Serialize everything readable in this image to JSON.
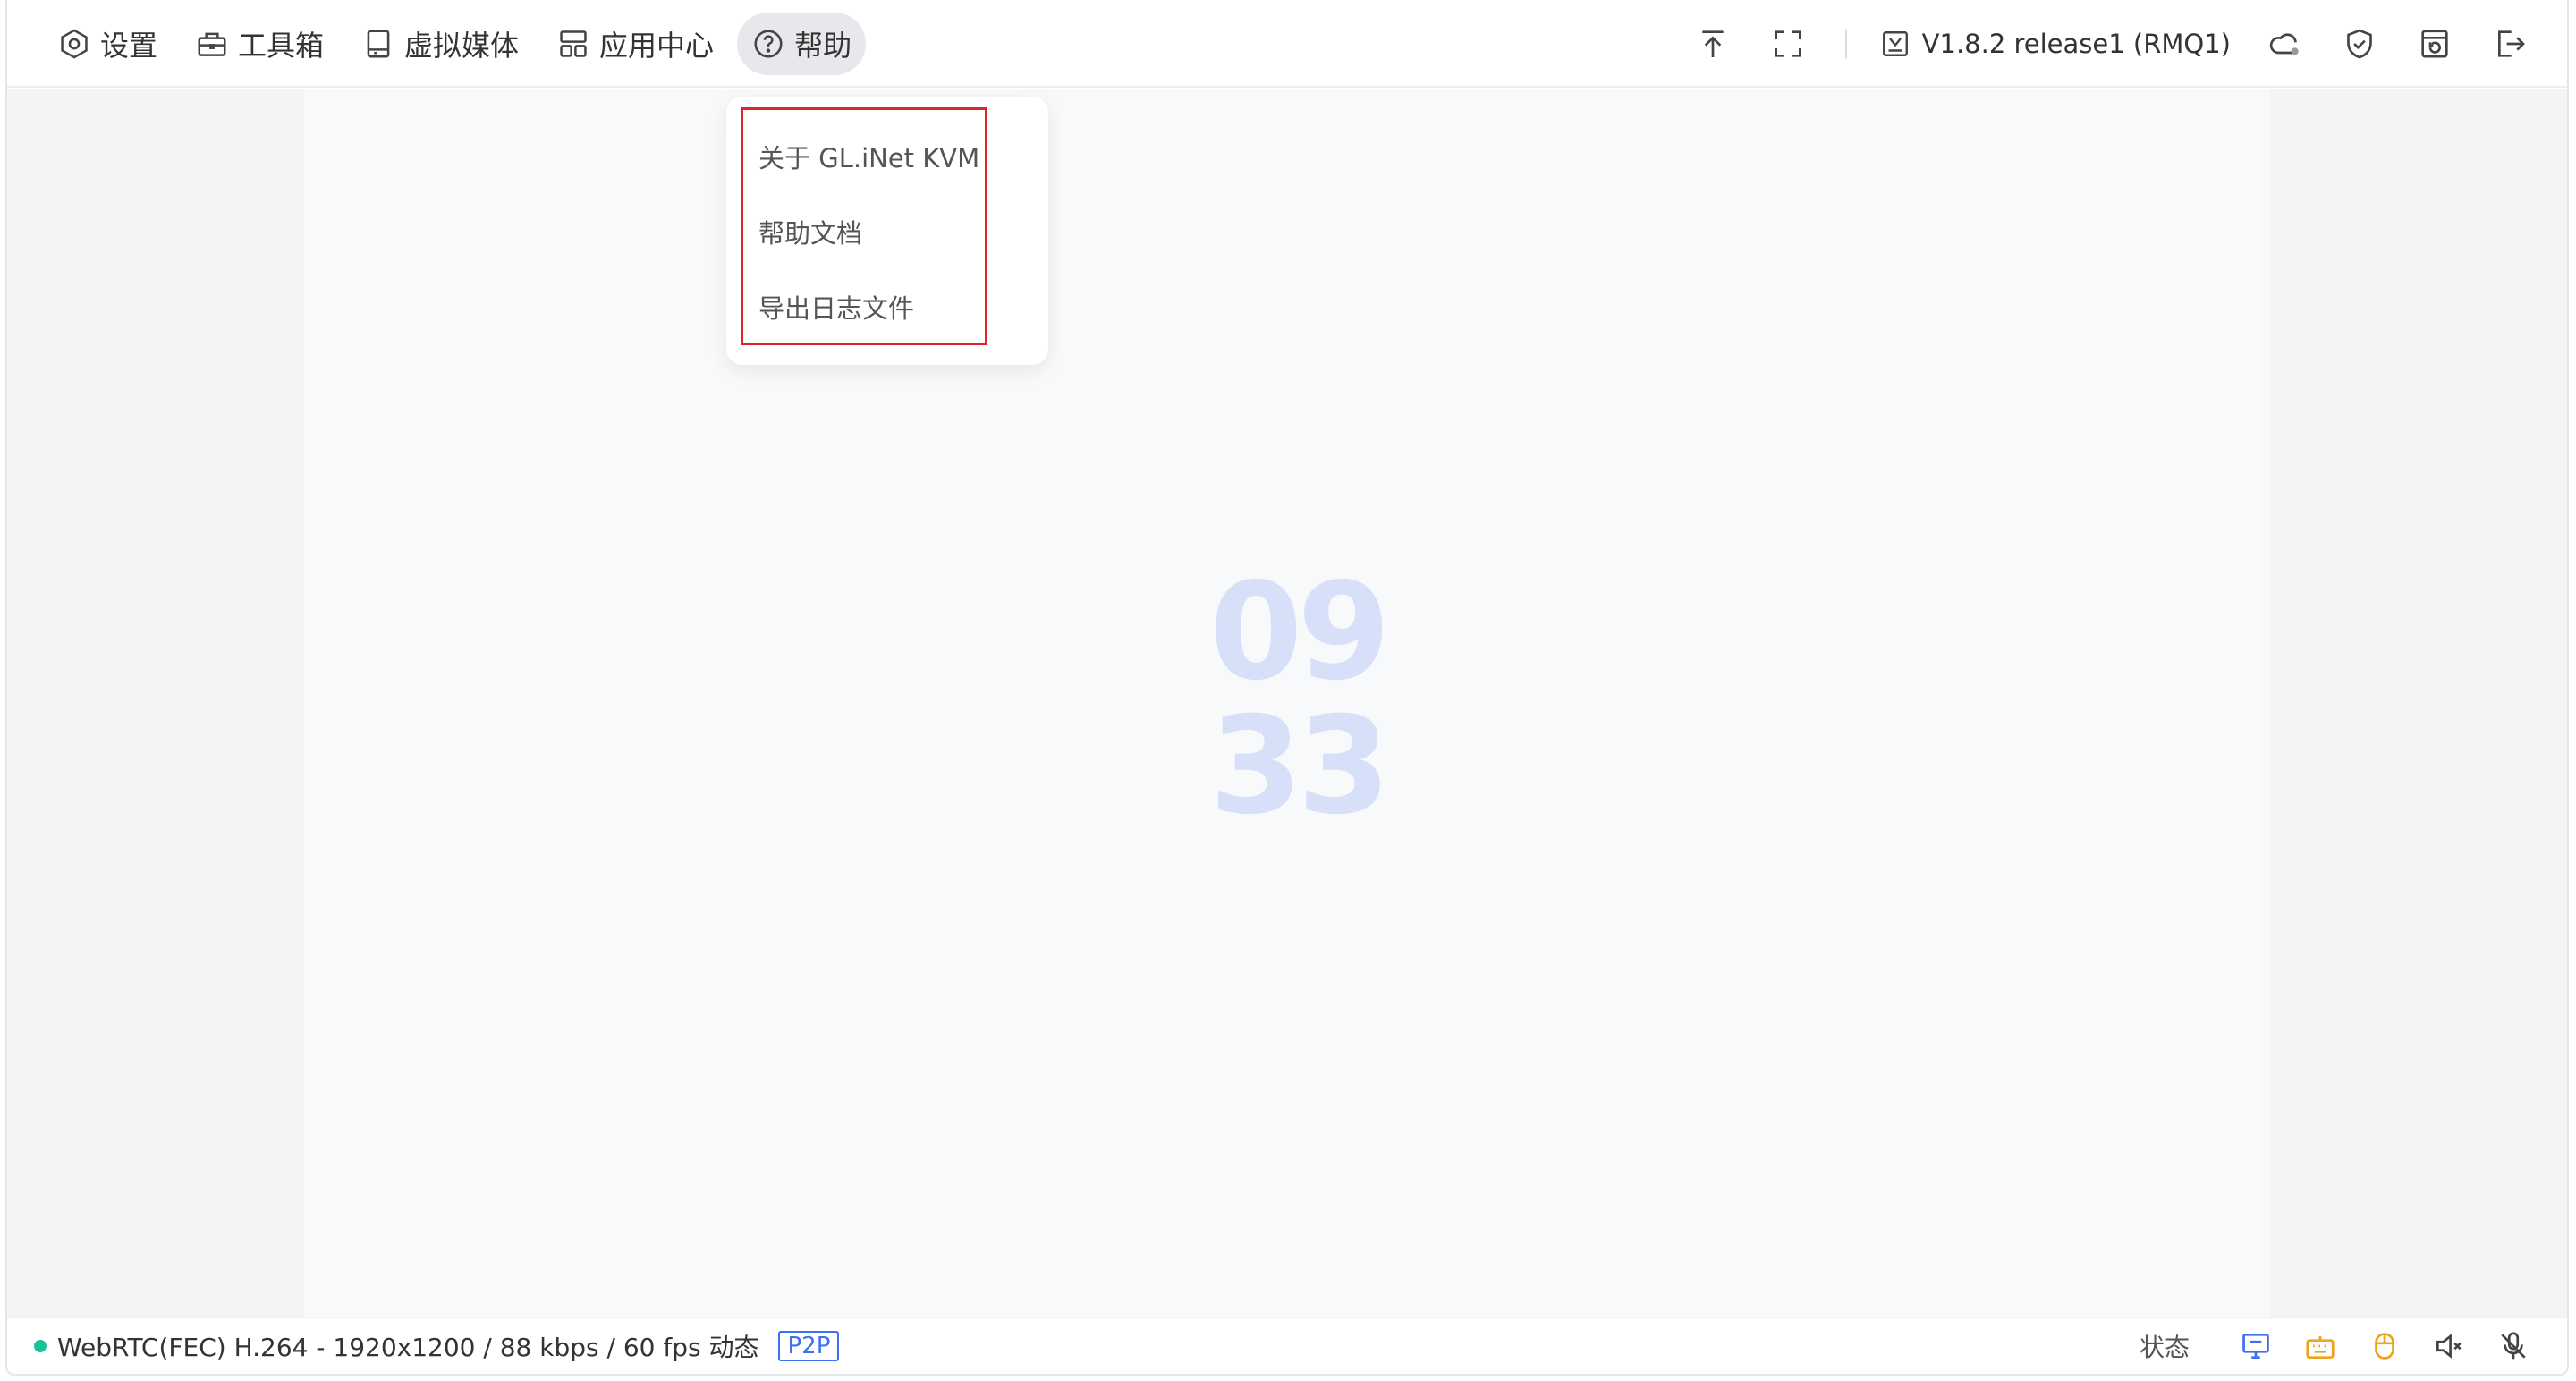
{
  "nav": {
    "items": [
      {
        "label": "设置",
        "icon": "settings-icon"
      },
      {
        "label": "工具箱",
        "icon": "toolbox-icon"
      },
      {
        "label": "虚拟媒体",
        "icon": "virtual-media-icon"
      },
      {
        "label": "应用中心",
        "icon": "app-center-icon"
      },
      {
        "label": "帮助",
        "icon": "help-icon",
        "active": true
      }
    ]
  },
  "toolbar": {
    "version": "V1.8.2 release1 (RMQ1)"
  },
  "help_menu": {
    "items": [
      "关于 GL.iNet KVM",
      "帮助文档",
      "导出日志文件"
    ]
  },
  "screen": {
    "clock_hour": "09",
    "clock_minute": "33"
  },
  "status": {
    "stream_info": "WebRTC(FEC) H.264 - 1920x1200 /  88 kbps / 60 fps 动态",
    "p2p_badge": "P2P",
    "state_label": "状态"
  },
  "colors": {
    "accent": "#3e6ff2",
    "connected": "#19c29b",
    "highlight_border": "#e0262d",
    "keyboard_icon": "#f0a21a"
  }
}
